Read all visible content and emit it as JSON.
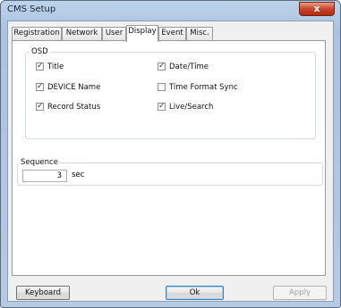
{
  "window": {
    "title": "CMS Setup",
    "close_label": "x"
  },
  "tabs": [
    {
      "label": "Registration"
    },
    {
      "label": "Network"
    },
    {
      "label": "User"
    },
    {
      "label": "Display",
      "active": true
    },
    {
      "label": "Event"
    },
    {
      "label": "Misc."
    }
  ],
  "osd": {
    "legend": "OSD",
    "options": [
      {
        "label": "Title",
        "checked": true
      },
      {
        "label": "Date/Time",
        "checked": true
      },
      {
        "label": "DEVICE Name",
        "checked": true
      },
      {
        "label": "Time Format Sync",
        "checked": false
      },
      {
        "label": "Record Status",
        "checked": true
      },
      {
        "label": "Live/Search",
        "checked": true
      }
    ]
  },
  "sequence": {
    "legend": "Sequence",
    "value": "3",
    "unit": "sec"
  },
  "buttons": {
    "keyboard": "Keyboard",
    "ok": "Ok",
    "apply": "Apply"
  }
}
